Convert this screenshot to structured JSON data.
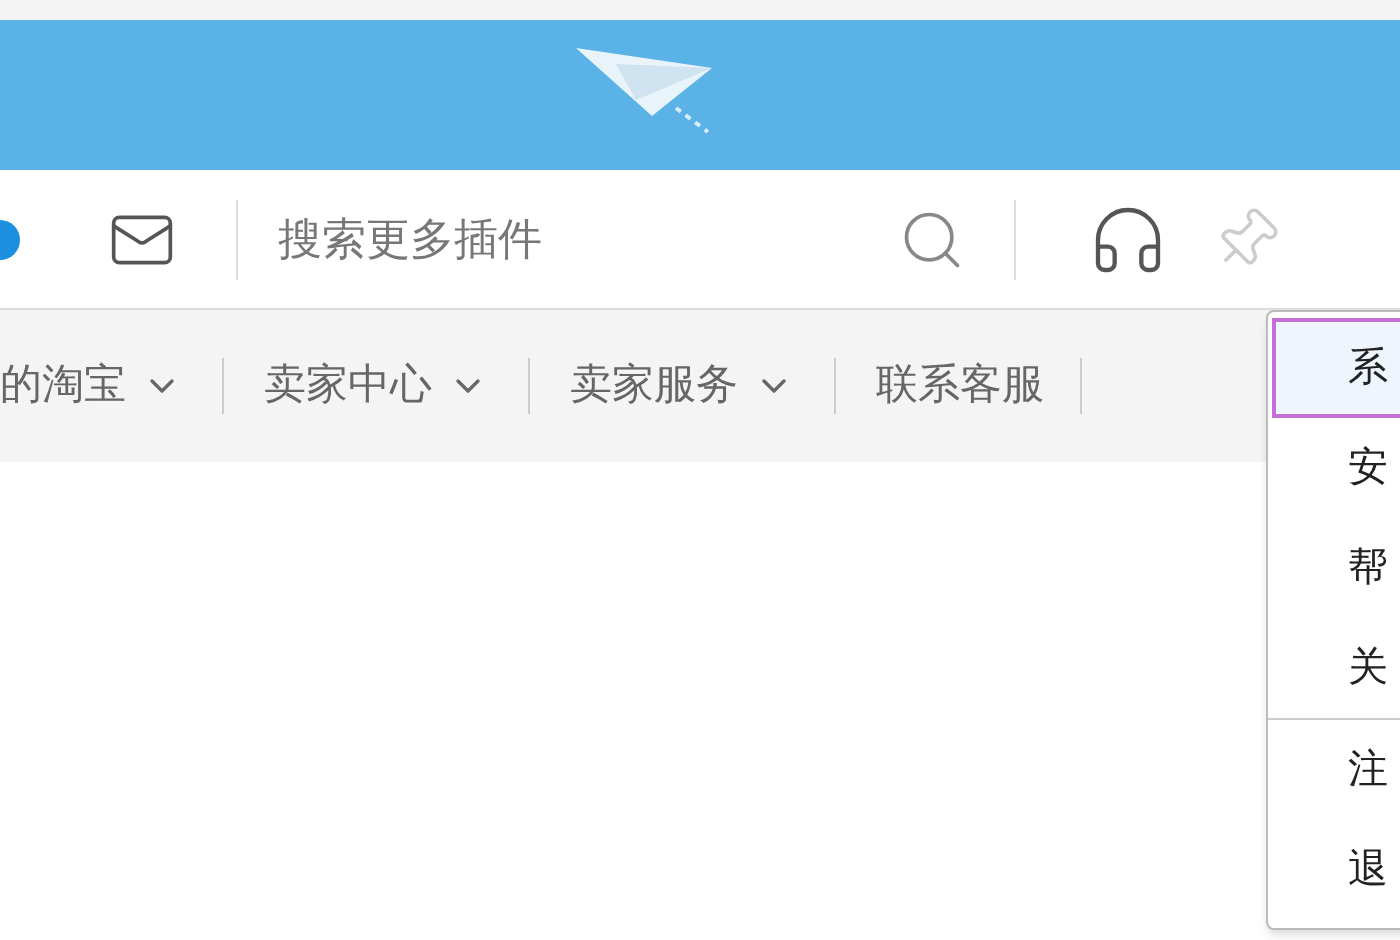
{
  "search": {
    "placeholder": "搜索更多插件"
  },
  "nav": [
    {
      "label": "的淘宝",
      "dropdown": true
    },
    {
      "label": "卖家中心",
      "dropdown": true
    },
    {
      "label": "卖家服务",
      "dropdown": true
    },
    {
      "label": "联系客服",
      "dropdown": false
    }
  ],
  "menu": [
    {
      "label": "系",
      "selected": true
    },
    {
      "label": "安",
      "selected": false
    },
    {
      "label": "帮",
      "selected": false
    },
    {
      "label": "关",
      "selected": false,
      "divider_after": true
    },
    {
      "label": "注",
      "selected": false
    },
    {
      "label": "退",
      "selected": false
    }
  ]
}
